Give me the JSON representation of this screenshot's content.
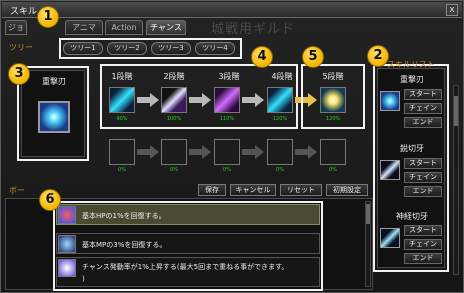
{
  "window": {
    "title": "スキル",
    "close_label": "x"
  },
  "main_tabs": [
    {
      "label": "ジョ"
    },
    {
      "label": "アニマ"
    },
    {
      "label": "Action"
    },
    {
      "label": "チャンス"
    }
  ],
  "guild_watermark": "城戦用ギルド",
  "tree_label": "ツリー",
  "sub_tabs": [
    "ツリー1",
    "ツリー2",
    "ツリー3",
    "ツリー4"
  ],
  "skill_preview": {
    "title": "重撃刃"
  },
  "stages": [
    {
      "label": "1段階",
      "percent": "90%",
      "icon": "slash-teal-icon"
    },
    {
      "label": "2段階",
      "percent": "100%",
      "icon": "slash-crossed-icon"
    },
    {
      "label": "3段階",
      "percent": "110%",
      "icon": "slash-purple-icon"
    },
    {
      "label": "4段階",
      "percent": "120%",
      "icon": "slash-teal-icon"
    },
    {
      "label": "5段階",
      "percent": "120%",
      "icon": "burst-gold-icon"
    }
  ],
  "empty_stages": [
    {
      "percent": "0%"
    },
    {
      "percent": "0%"
    },
    {
      "percent": "0%"
    },
    {
      "percent": "0%"
    },
    {
      "percent": "0%"
    }
  ],
  "skill_list": {
    "title": "スキルリスト",
    "entries": [
      {
        "name": "重撃刃",
        "buttons": [
          "スタート",
          "チェイン",
          "エンド"
        ]
      },
      {
        "name": "鋭切牙",
        "buttons": [
          "スタート",
          "チェイン",
          "エンド"
        ]
      },
      {
        "name": "神経切牙",
        "buttons": [
          "スタート",
          "チェイン",
          "エンド"
        ]
      }
    ]
  },
  "controls": {
    "save": "保存",
    "cancel": "キャンセル",
    "reset": "リセット",
    "init": "初期設定"
  },
  "bonus_label": "ボー",
  "passives": [
    {
      "text": "基本HPの1%を回復する。"
    },
    {
      "text": "基本MPの3%を回復する。"
    },
    {
      "text": "チャンス発動率が1%上昇する(最大5回まで重ねる事ができます。"
    },
    {
      "text": ")"
    }
  ],
  "callouts": [
    "1",
    "2",
    "3",
    "4",
    "5",
    "6"
  ]
}
